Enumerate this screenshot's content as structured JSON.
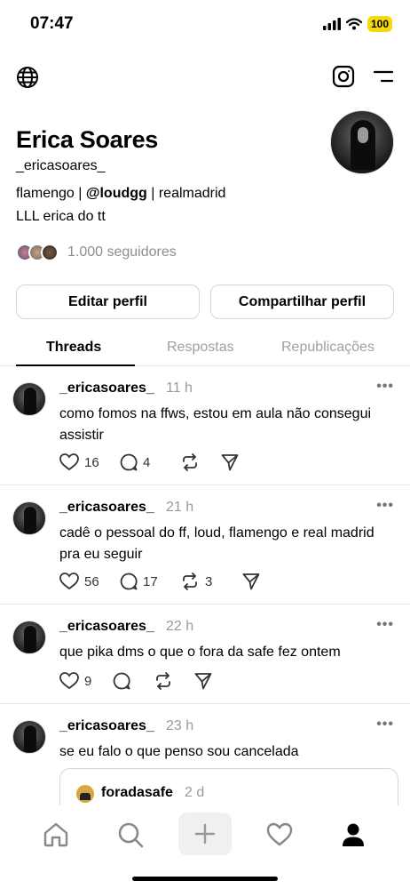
{
  "status_bar": {
    "time": "07:47",
    "battery": "100"
  },
  "profile": {
    "name": "Erica Soares",
    "handle": "_ericasoares_",
    "bio_line1_before": "flamengo | ",
    "bio_line1_mention": "@loudgg",
    "bio_line1_after": " | realmadrid",
    "bio_line2": "LLL erica do tt",
    "followers_text": "1.000 seguidores"
  },
  "buttons": {
    "edit": "Editar perfil",
    "share": "Compartilhar perfil"
  },
  "tabs": [
    "Threads",
    "Respostas",
    "Republicações"
  ],
  "posts": [
    {
      "user": "_ericasoares_",
      "time": "11 h",
      "text": "como fomos na ffws, estou em aula não consegui assistir",
      "likes": "16",
      "comments": "4",
      "reposts": ""
    },
    {
      "user": "_ericasoares_",
      "time": "21 h",
      "text": "cadê o pessoal do ff, loud, flamengo e real madrid pra eu seguir",
      "likes": "56",
      "comments": "17",
      "reposts": "3"
    },
    {
      "user": "_ericasoares_",
      "time": "22 h",
      "text": "que pika dms o que o fora da safe fez ontem",
      "likes": "9",
      "comments": "",
      "reposts": ""
    },
    {
      "user": "_ericasoares_",
      "time": "23 h",
      "text": "se eu falo o que penso sou cancelada",
      "quote": {
        "user": "foradasafe",
        "time": "2 d"
      }
    }
  ],
  "more_glyph": "•••",
  "icons": {
    "top_bar": [
      "globe-icon",
      "instagram-icon",
      "menu-icon"
    ],
    "post_actions": [
      "heart-icon",
      "comment-icon",
      "repost-icon",
      "share-icon"
    ],
    "bottom_nav": [
      "home-icon",
      "search-icon",
      "add-icon",
      "activity-heart-icon",
      "profile-icon"
    ]
  }
}
